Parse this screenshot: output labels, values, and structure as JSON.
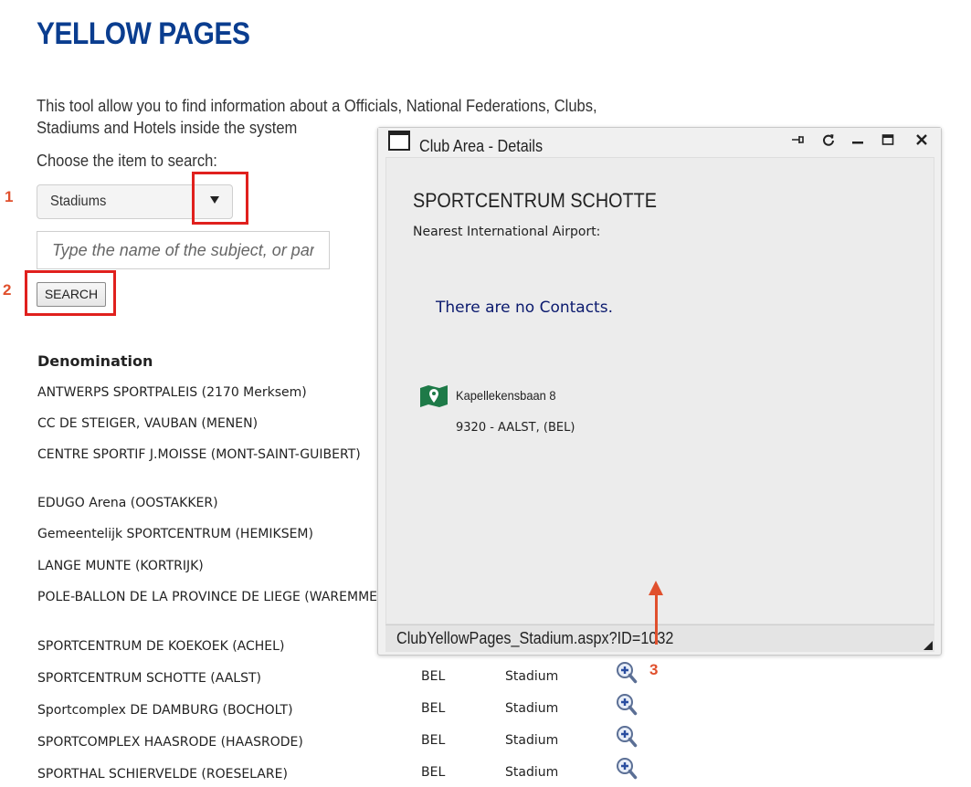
{
  "page": {
    "title": "YELLOW PAGES",
    "intro": "This tool allow you to find information about a Officials, National Federations, Clubs, Stadiums and Hotels inside the system",
    "choose_label": "Choose the item to search:",
    "select_value": "Stadiums",
    "search_placeholder": "Type the name of the subject, or par",
    "search_button": "SEARCH"
  },
  "annotations": {
    "marker1": "1",
    "marker2": "2",
    "marker3": "3",
    "color": "#e0201d"
  },
  "results": {
    "header": "Denomination",
    "rows": [
      {
        "name": "ANTWERPS SPORTPALEIS (2170 Merksem)",
        "country": "",
        "type": ""
      },
      {
        "name": "CC DE STEIGER, VAUBAN (MENEN)",
        "country": "",
        "type": ""
      },
      {
        "name": "CENTRE SPORTIF J.MOISSE (MONT-SAINT-GUIBERT)",
        "country": "",
        "type": ""
      },
      {
        "name": "EDUGO Arena (OOSTAKKER)",
        "country": "",
        "type": ""
      },
      {
        "name": "Gemeentelijk SPORTCENTRUM (HEMIKSEM)",
        "country": "",
        "type": ""
      },
      {
        "name": "LANGE MUNTE (KORTRIJK)",
        "country": "",
        "type": ""
      },
      {
        "name": "POLE-BALLON DE LA PROVINCE DE LIEGE (WAREMME)",
        "country": "",
        "type": ""
      },
      {
        "name": "SPORTCENTRUM DE KOEKOEK (ACHEL)",
        "country": "",
        "type": ""
      },
      {
        "name": "SPORTCENTRUM SCHOTTE (AALST)",
        "country": "BEL",
        "type": "Stadium"
      },
      {
        "name": "Sportcomplex DE DAMBURG (BOCHOLT)",
        "country": "BEL",
        "type": "Stadium"
      },
      {
        "name": "SPORTCOMPLEX HAASRODE (HAASRODE)",
        "country": "BEL",
        "type": "Stadium"
      },
      {
        "name": "SPORTHAL SCHIERVELDE (ROESELARE)",
        "country": "BEL",
        "type": "Stadium"
      }
    ]
  },
  "dialog": {
    "title": "Club Area - Details",
    "club_name": "SPORTCENTRUM SCHOTTE",
    "airport_label": "Nearest International Airport:",
    "contacts_text": "There are no Contacts.",
    "address_line1": "Kapellekensbaan 8",
    "address_line2": "9320 - AALST,   (BEL)",
    "status_url": "ClubYellowPages_Stadium.aspx?ID=1032",
    "map_icon_color": "#1e7a48"
  }
}
